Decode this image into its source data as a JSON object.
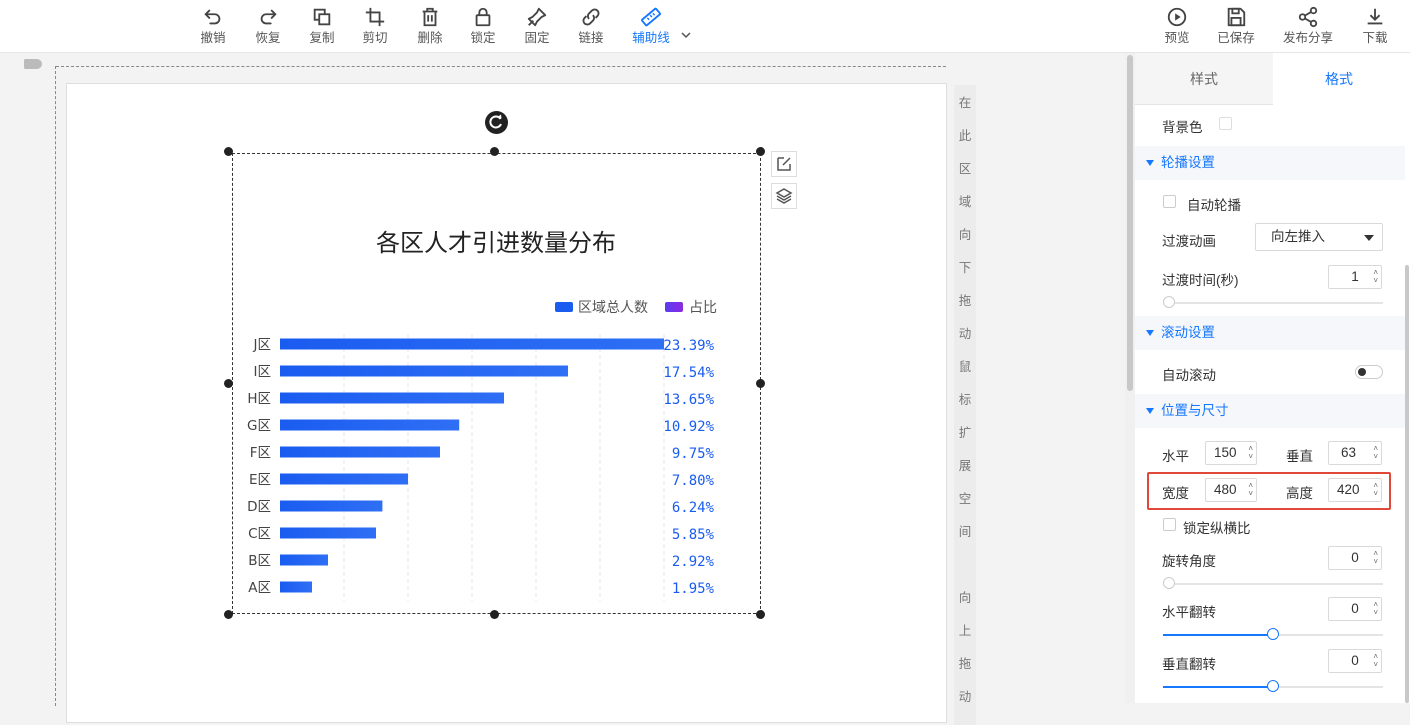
{
  "toolbar": {
    "left_tools": [
      {
        "key": "undo",
        "label": "撤销"
      },
      {
        "key": "redo",
        "label": "恢复"
      },
      {
        "key": "copy",
        "label": "复制"
      },
      {
        "key": "crop",
        "label": "剪切"
      },
      {
        "key": "delete",
        "label": "删除"
      },
      {
        "key": "lock",
        "label": "锁定"
      },
      {
        "key": "pin",
        "label": "固定"
      },
      {
        "key": "link",
        "label": "链接"
      },
      {
        "key": "guide",
        "label": "辅助线"
      }
    ],
    "right_tools": [
      {
        "key": "preview",
        "label": "预览"
      },
      {
        "key": "saved",
        "label": "已保存"
      },
      {
        "key": "share",
        "label": "发布分享"
      },
      {
        "key": "download",
        "label": "下载"
      }
    ]
  },
  "canvas": {
    "side_hint_top": [
      "在",
      "此",
      "区",
      "域",
      "向",
      "下",
      "拖",
      "动",
      "鼠",
      "标",
      "扩",
      "展",
      "空",
      "间"
    ],
    "side_hint_bottom": [
      "向",
      "上",
      "拖",
      "动"
    ]
  },
  "chart_data": {
    "type": "bar",
    "orientation": "horizontal",
    "title": "各区人才引进数量分布",
    "categories": [
      "J区",
      "I区",
      "H区",
      "G区",
      "F区",
      "E区",
      "D区",
      "C区",
      "B区",
      "A区"
    ],
    "series": [
      {
        "name": "区域总人数",
        "values": [
          12000,
          9000,
          7000,
          5600,
          5000,
          4000,
          3200,
          3000,
          1500,
          1000
        ],
        "color": "#1a5cf0"
      },
      {
        "name": "占比",
        "labels": [
          "23.39%",
          "17.54%",
          "13.65%",
          "10.92%",
          "9.75%",
          "7.80%",
          "6.24%",
          "5.85%",
          "2.92%",
          "1.95%"
        ],
        "color": "#7b2ff7"
      }
    ],
    "x_ticks": [
      "0",
      "2000",
      "4000",
      "6000",
      "8000",
      "10000",
      "12000"
    ],
    "xlim": [
      0,
      12000
    ],
    "legend_position": "top-right",
    "label_color": "#1a5cf0"
  },
  "panel": {
    "tabs": [
      "样式",
      "格式"
    ],
    "active_tab": "格式",
    "bg_color_label": "背景色",
    "carousel": {
      "title": "轮播设置",
      "auto_label": "自动轮播",
      "transition_label": "过渡动画",
      "transition_value": "向左推入",
      "duration_label": "过渡时间(秒)",
      "duration_value": "1"
    },
    "scroll": {
      "title": "滚动设置",
      "auto_label": "自动滚动"
    },
    "position": {
      "title": "位置与尺寸",
      "h_label": "水平",
      "h_value": "150",
      "v_label": "垂直",
      "v_value": "63",
      "w_label": "宽度",
      "w_value": "480",
      "ht_label": "高度",
      "ht_value": "420",
      "lock_label": "锁定纵横比",
      "rotate_label": "旋转角度",
      "rotate_value": "0",
      "hflip_label": "水平翻转",
      "hflip_value": "0",
      "vflip_label": "垂直翻转",
      "vflip_value": "0"
    }
  }
}
